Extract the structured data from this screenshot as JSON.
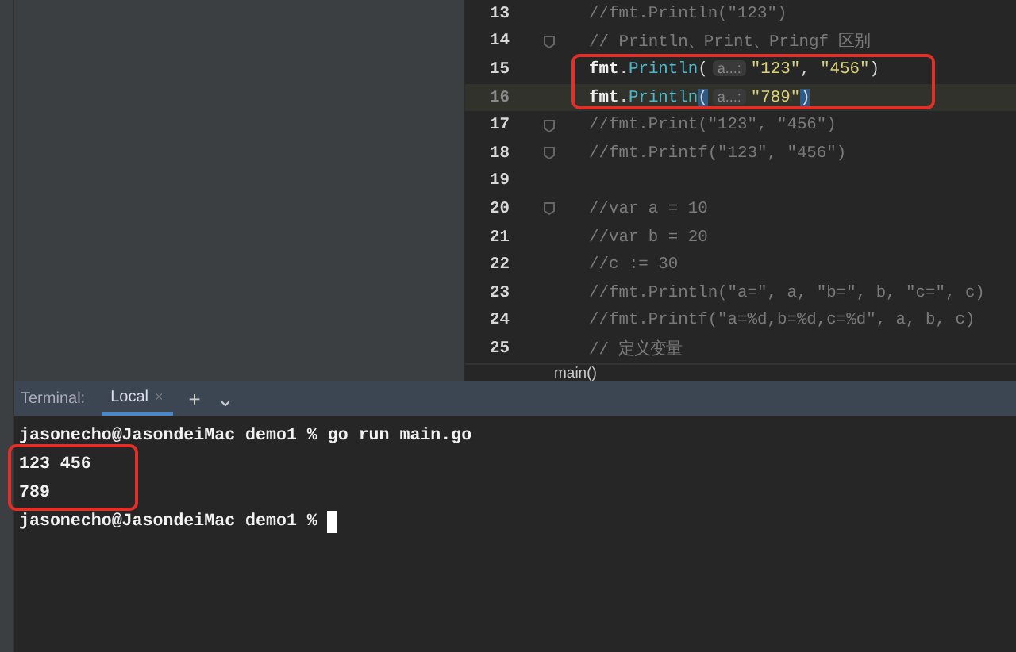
{
  "editor": {
    "lines": [
      {
        "number": "13",
        "current": false,
        "fold": false,
        "tokens": [
          {
            "kind": "comment",
            "text": "//fmt.Println(\"123\")"
          }
        ]
      },
      {
        "number": "14",
        "current": false,
        "fold": true,
        "tokens": [
          {
            "kind": "comment",
            "text": "// Println、Print、Pringf 区别"
          }
        ]
      },
      {
        "number": "15",
        "current": false,
        "fold": false,
        "tokens": [
          {
            "kind": "pkg",
            "text": "fmt"
          },
          {
            "kind": "punct",
            "text": "."
          },
          {
            "kind": "func",
            "text": "Println"
          },
          {
            "kind": "punct",
            "text": "("
          },
          {
            "kind": "hint",
            "text": "a...:"
          },
          {
            "kind": "string",
            "text": "\"123\""
          },
          {
            "kind": "punct",
            "text": ", "
          },
          {
            "kind": "string",
            "text": "\"456\""
          },
          {
            "kind": "punct",
            "text": ")"
          }
        ]
      },
      {
        "number": "16",
        "current": true,
        "fold": false,
        "tokens": [
          {
            "kind": "pkg",
            "text": "fmt"
          },
          {
            "kind": "punct",
            "text": "."
          },
          {
            "kind": "func",
            "text": "Println"
          },
          {
            "kind": "match",
            "text": "("
          },
          {
            "kind": "hint",
            "text": "a...:"
          },
          {
            "kind": "string",
            "text": "\"789\""
          },
          {
            "kind": "match",
            "text": ")"
          }
        ]
      },
      {
        "number": "17",
        "current": false,
        "fold": true,
        "tokens": [
          {
            "kind": "comment",
            "text": "//fmt.Print(\"123\", \"456\")"
          }
        ]
      },
      {
        "number": "18",
        "current": false,
        "fold": true,
        "tokens": [
          {
            "kind": "comment",
            "text": "//fmt.Printf(\"123\", \"456\")"
          }
        ]
      },
      {
        "number": "19",
        "current": false,
        "fold": false
      },
      {
        "number": "20",
        "current": false,
        "fold": true,
        "tokens": [
          {
            "kind": "comment",
            "text": "//var a = 10"
          }
        ]
      },
      {
        "number": "21",
        "current": false,
        "fold": false,
        "tokens": [
          {
            "kind": "comment",
            "text": "//var b = 20"
          }
        ]
      },
      {
        "number": "22",
        "current": false,
        "fold": false,
        "tokens": [
          {
            "kind": "comment",
            "text": "//c := 30"
          }
        ]
      },
      {
        "number": "23",
        "current": false,
        "fold": false,
        "tokens": [
          {
            "kind": "comment",
            "text": "//fmt.Println(\"a=\", a, \"b=\", b, \"c=\", c)"
          }
        ]
      },
      {
        "number": "24",
        "current": false,
        "fold": false,
        "tokens": [
          {
            "kind": "comment",
            "text": "//fmt.Printf(\"a=%d,b=%d,c=%d\", a, b, c)"
          }
        ]
      },
      {
        "number": "25",
        "current": false,
        "fold": false,
        "tokens": [
          {
            "kind": "comment",
            "text": "// 定义变量"
          }
        ]
      }
    ],
    "breadcrumb": "main()"
  },
  "terminal": {
    "label": "Terminal:",
    "tabs": [
      {
        "label": "Local",
        "selected": true,
        "close": "×"
      }
    ],
    "add": "+",
    "menu": "⌄",
    "lines": [
      "jasonecho@JasondeiMac demo1 % go run main.go",
      "123 456",
      "789",
      "jasonecho@JasondeiMac demo1 %"
    ]
  }
}
